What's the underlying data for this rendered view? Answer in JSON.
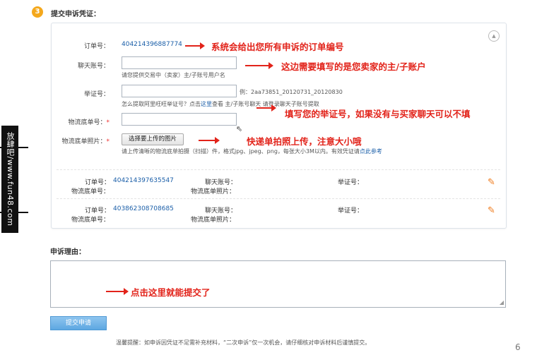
{
  "step": {
    "number": "3",
    "title": "提交申诉凭证："
  },
  "form": {
    "order_label": "订单号：",
    "order_value": "404214396887774",
    "chat_label": "聊天账号：",
    "chat_hint": "请您提供交易中（卖家）主/子账号用户名",
    "evidence_label": "举证号：",
    "evidence_example": "例：2aa73851_20120731_20120830",
    "evidence_hint_prefix": "怎么提取阿里旺旺举证号？点击",
    "evidence_hint_link": "这里",
    "evidence_hint_suffix": "查看 主/子账号聊天 请登录聊天子账号提取",
    "logistics_label": "物流底单号：",
    "logistics_photo_label": "物流底单照片：",
    "required_mark": "*",
    "upload_button": "选择要上传的图片",
    "upload_hint_prefix": "请上传清晰的物流底单拍摄（扫描）件，格式jpg、jpeg、png，每张大小3M以内。有效凭证请",
    "upload_hint_link": "点此参考",
    "collapse_icon": "chevron-up-icon"
  },
  "annotations": {
    "a1": "系统会给出您所有申诉的订单编号",
    "a2": "这边需要填写的是您卖家的主/子账户",
    "a3": "填写您的举证号，如果没有与买家聊天可以不填",
    "a4": "快递单拍照上传，注意大小哦",
    "a5": "点击这里就能提交了"
  },
  "orders": [
    {
      "order_label": "订单号：",
      "order_no": "404214397635547",
      "chat_label": "聊天账号：",
      "evidence_label": "举证号：",
      "photo_label": "物流底单照片：",
      "logistics_label": "物流底单号：",
      "edit_icon": "pencil-icon"
    },
    {
      "order_label": "订单号：",
      "order_no": "403862308708685",
      "chat_label": "聊天账号：",
      "evidence_label": "举证号：",
      "photo_label": "物流底单照片：",
      "logistics_label": "物流底单号：",
      "edit_icon": "pencil-icon"
    }
  ],
  "reason": {
    "title": "申诉理由："
  },
  "submit": {
    "label": "提交申请"
  },
  "tip": "温馨提醒：如申诉因凭证不足需补充材料，“二次申诉”仅一次机会，请仔细核对申诉材料后谨慎提交。",
  "page_number": "6",
  "watermark": "放肆吧/www.fun48.com",
  "colors": {
    "accent_red": "#e2231a",
    "link_blue": "#1a5ea8",
    "step_orange": "#f4a81c",
    "edit_orange": "#ef7b1c"
  }
}
